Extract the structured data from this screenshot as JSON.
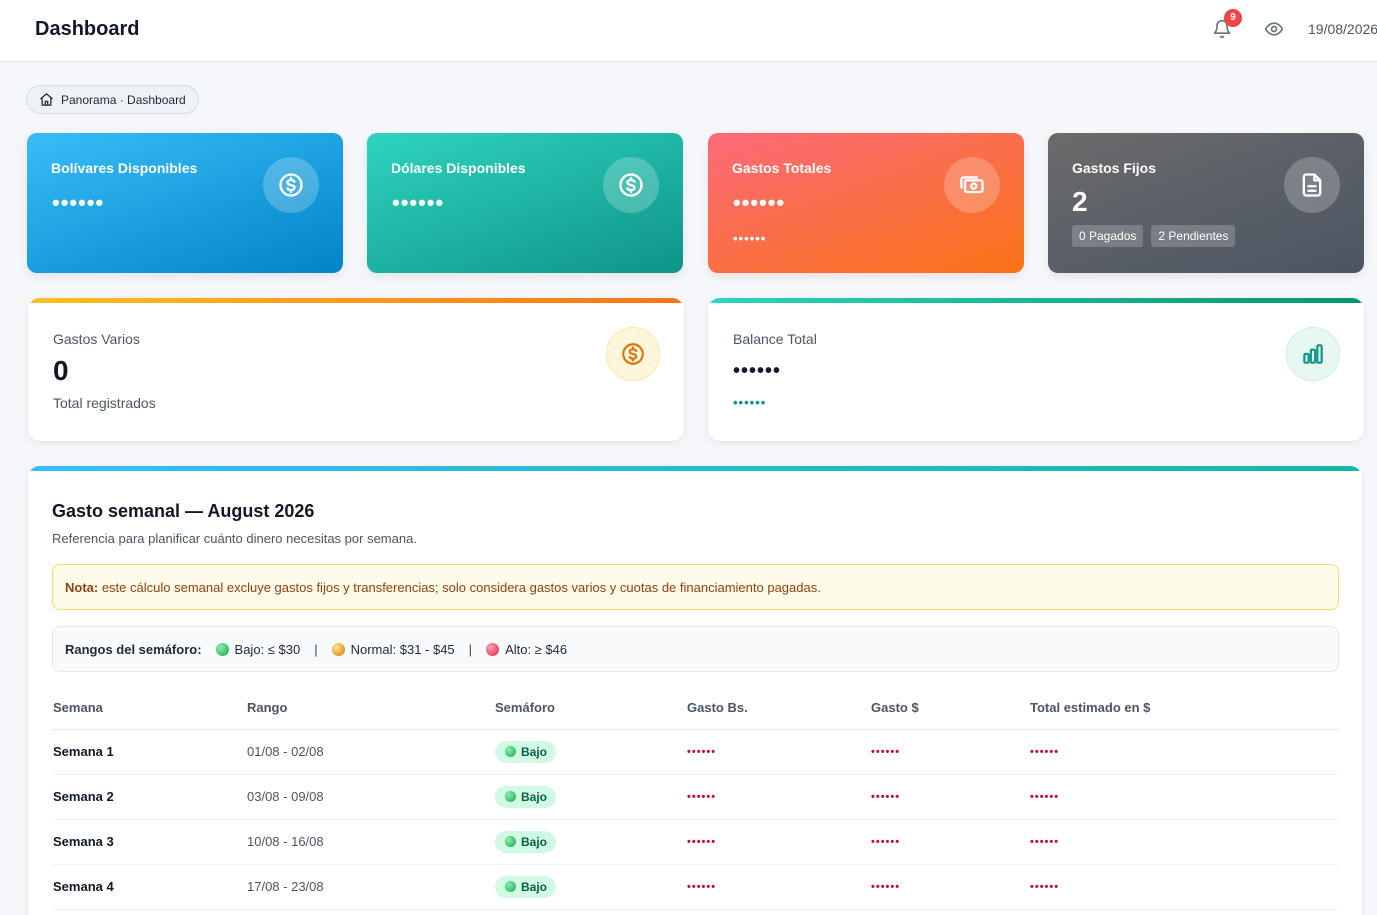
{
  "header": {
    "title": "Dashboard",
    "notifications": "9",
    "date": "19/08/2026"
  },
  "breadcrumb": {
    "label": "Panorama · Dashboard"
  },
  "stats": [
    {
      "label": "Bolívares Disponibles",
      "value": "••••••",
      "icon": "dollar-circle-icon"
    },
    {
      "label": "Dólares Disponibles",
      "value": "••••••",
      "icon": "dollar-circle-icon"
    },
    {
      "label": "Gastos Totales",
      "value": "••••••",
      "secondary": "••••••",
      "icon": "cash-icon"
    },
    {
      "label": "Gastos Fijos",
      "value": "2",
      "paid": "0 Pagados",
      "pending": "2 Pendientes",
      "icon": "document-icon"
    }
  ],
  "varios": {
    "label": "Gastos Varios",
    "value": "0",
    "sub": "Total registrados",
    "icon": "coin-icon"
  },
  "balance": {
    "label": "Balance Total",
    "value": "••••••",
    "secondary": "••••••",
    "icon": "bar-chart-icon"
  },
  "weekly": {
    "title": "Gasto semanal — August 2026",
    "description": "Referencia para planificar cuánto dinero necesitas por semana.",
    "note_label": "Nota:",
    "note_text": " este cálculo semanal excluye gastos fijos y transferencias; solo considera gastos varios y cuotas de financiamiento pagadas.",
    "ranges_title": "Rangos del semáforo:",
    "ranges": {
      "low": "Bajo: ≤ $30",
      "normal": "Normal: $31 - $45",
      "high": "Alto: ≥ $46",
      "separator": "|"
    },
    "colors": {
      "low": "#16a34a",
      "normal": "#d97706",
      "high": "#e11d48"
    },
    "columns": [
      "Semana",
      "Rango",
      "Semáforo",
      "Gasto Bs.",
      "Gasto $",
      "Total estimado en $"
    ],
    "rows": [
      {
        "week": "Semana 1",
        "range": "01/08 - 02/08",
        "status": "Bajo",
        "bs": "••••••",
        "usd": "••••••",
        "total": "••••••"
      },
      {
        "week": "Semana 2",
        "range": "03/08 - 09/08",
        "status": "Bajo",
        "bs": "••••••",
        "usd": "••••••",
        "total": "••••••"
      },
      {
        "week": "Semana 3",
        "range": "10/08 - 16/08",
        "status": "Bajo",
        "bs": "••••••",
        "usd": "••••••",
        "total": "••••••"
      },
      {
        "week": "Semana 4",
        "range": "17/08 - 23/08",
        "status": "Bajo",
        "bs": "••••••",
        "usd": "••••••",
        "total": "••••••"
      }
    ]
  }
}
